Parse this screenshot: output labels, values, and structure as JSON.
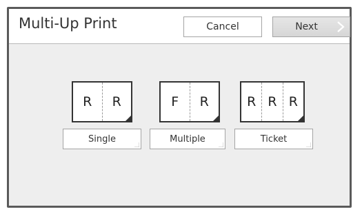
{
  "header": {
    "title": "Multi-Up Print",
    "cancel_label": "Cancel",
    "next_label": "Next"
  },
  "options": [
    {
      "label": "Single",
      "cells": [
        "R",
        "R"
      ]
    },
    {
      "label": "Multiple",
      "cells": [
        "F",
        "R"
      ]
    },
    {
      "label": "Ticket",
      "cells": [
        "R",
        "R",
        "R"
      ]
    }
  ],
  "icons": {
    "next": "chevron-right-icon",
    "thumbnail_corner": "page-dogear-icon"
  }
}
